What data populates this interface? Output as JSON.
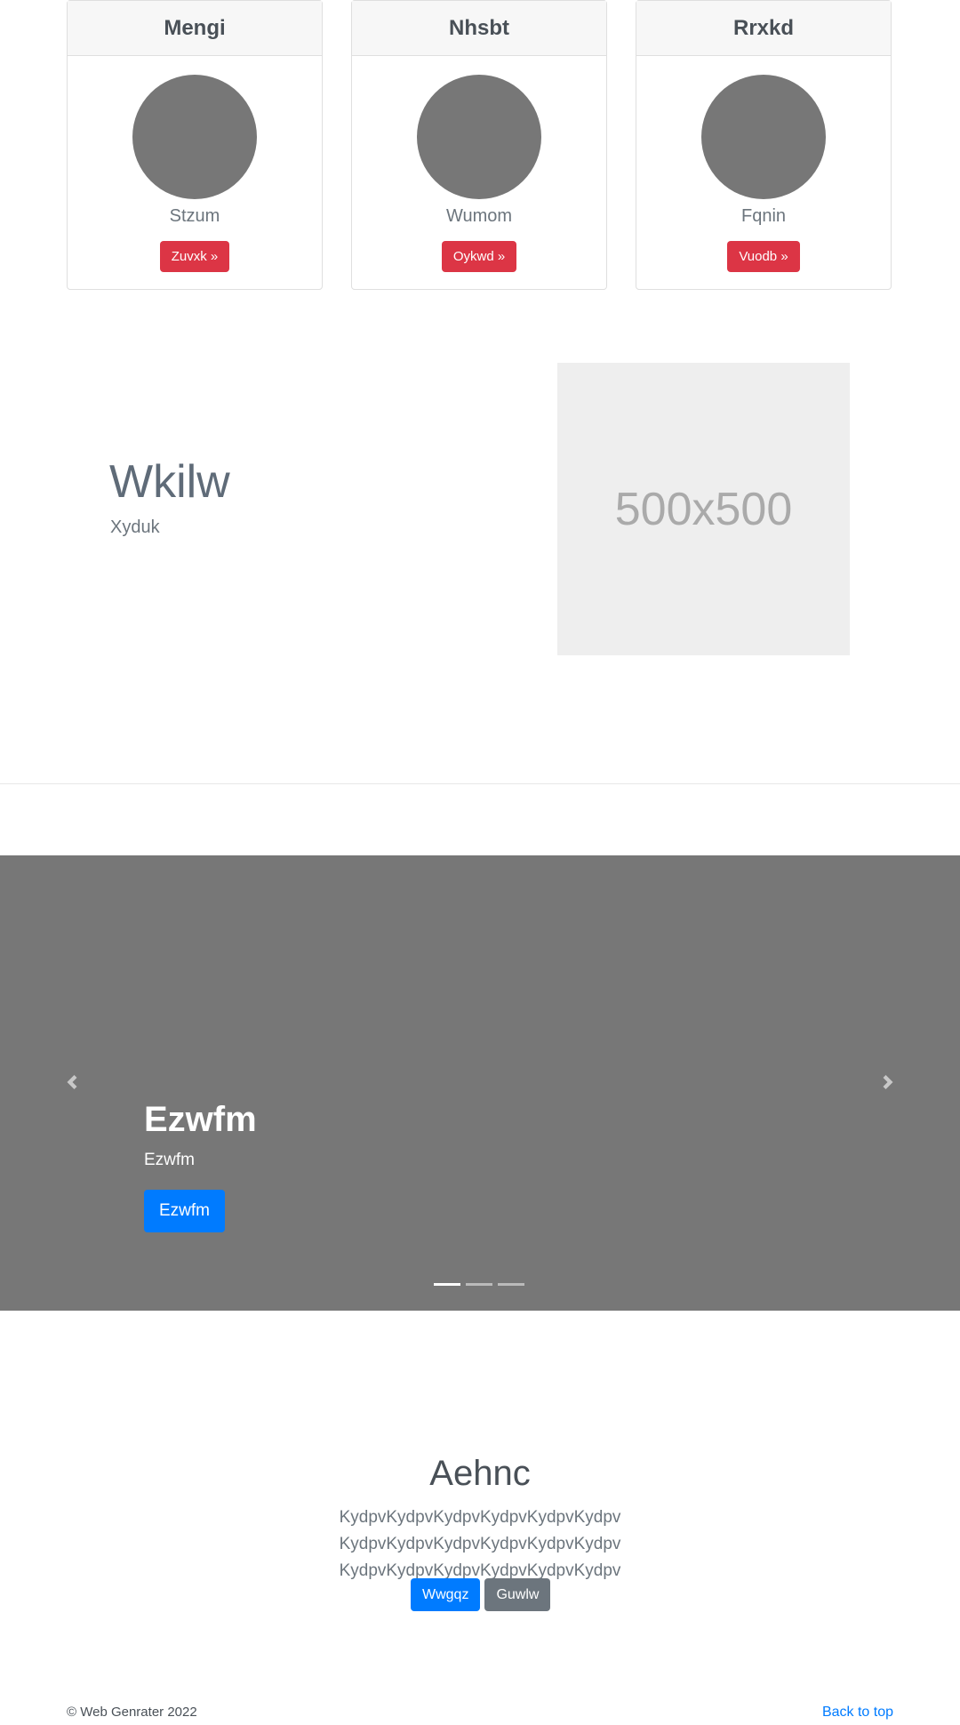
{
  "cards": [
    {
      "title": "Mengi",
      "subtitle": "Stzum",
      "button": "Zuvxk »"
    },
    {
      "title": "Nhsbt",
      "subtitle": "Wumom",
      "button": "Oykwd »"
    },
    {
      "title": "Rrxkd",
      "subtitle": "Fqnin",
      "button": "Vuodb »"
    }
  ],
  "feature": {
    "title": "Wkilw",
    "subtitle": "Xyduk",
    "image_placeholder": "500x500"
  },
  "carousel": {
    "caption_title": "Ezwfm",
    "caption_text": "Ezwfm",
    "caption_button": "Ezwfm",
    "icons": {
      "prev": "chevron-left-icon",
      "next": "chevron-right-icon"
    },
    "indicator_count": 3,
    "active_indicator": 0
  },
  "jumbotron": {
    "title": "Aehnc",
    "text": "KydpvKydpvKydpvKydpvKydpvKydpv KydpvKydpvKydpvKydpvKydpvKydpv KydpvKydpvKydpvKydpvKydpvKydpv",
    "primary_button": "Wwgqz",
    "secondary_button": "Guwlw"
  },
  "footer": {
    "copyright": "© Web Genrater 2022",
    "back_to_top": "Back to top"
  },
  "colors": {
    "danger": "#dc3545",
    "primary": "#007bff",
    "secondary": "#6c757d",
    "carousel_bg": "#777777",
    "placeholder_bg": "#eeeeee"
  }
}
